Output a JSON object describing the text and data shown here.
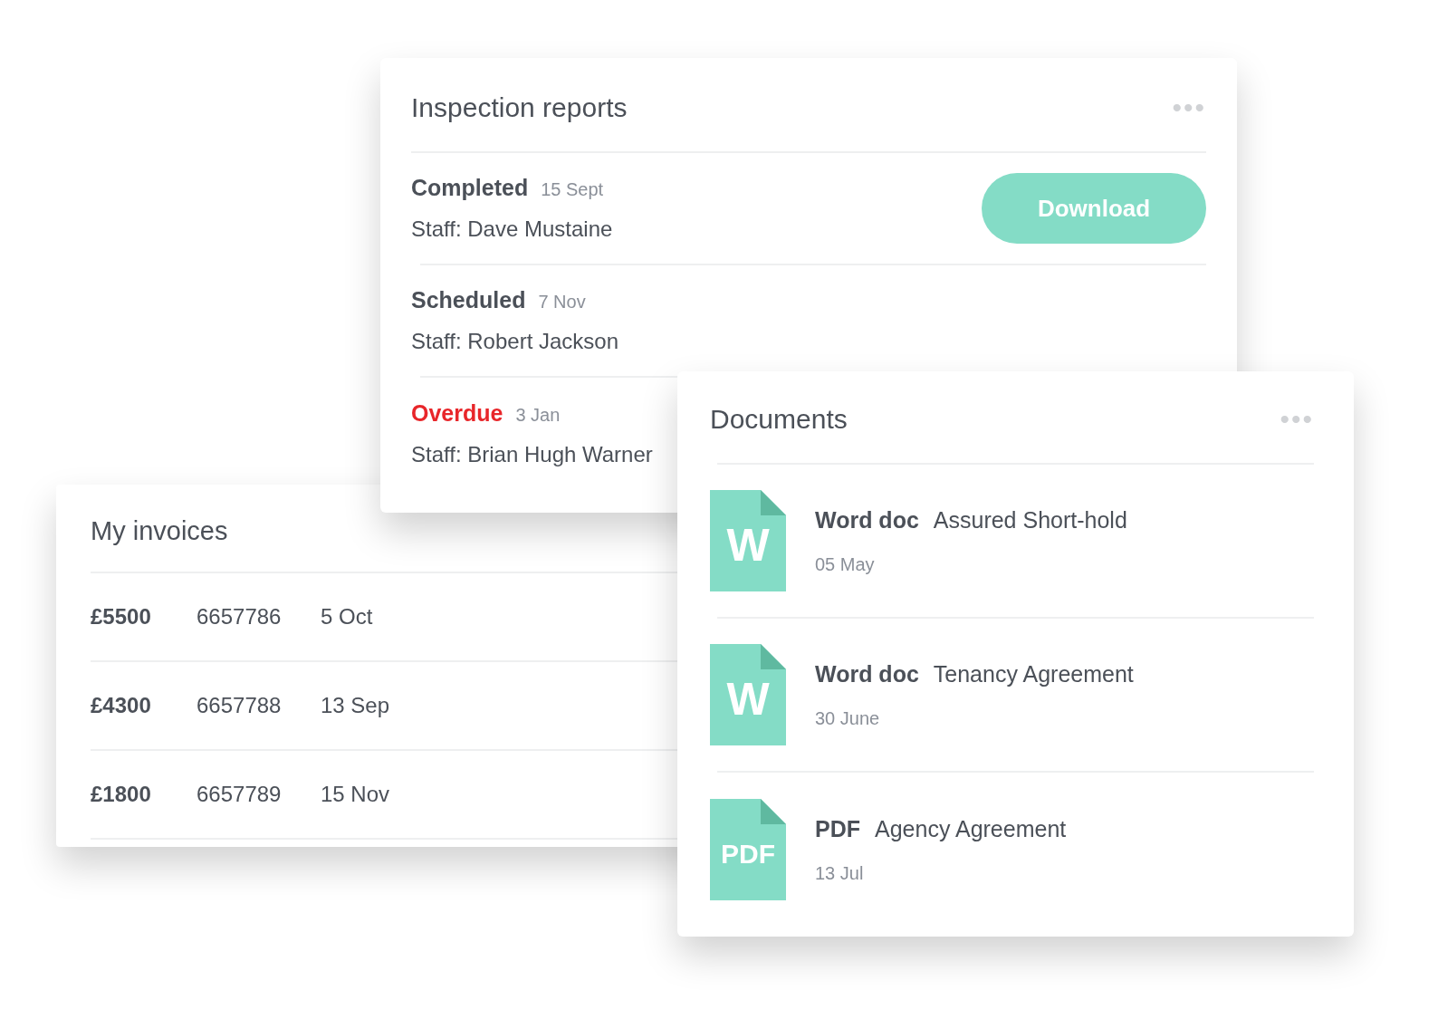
{
  "inspection": {
    "title": "Inspection reports",
    "menu": "•••",
    "rows": [
      {
        "status": "Completed",
        "kind": "normal",
        "date": "15 Sept",
        "staff": "Staff: Dave Mustaine",
        "action": "Download"
      },
      {
        "status": "Scheduled",
        "kind": "normal",
        "date": "7 Nov",
        "staff": "Staff: Robert Jackson"
      },
      {
        "status": "Overdue",
        "kind": "overdue",
        "date": "3 Jan",
        "staff": "Staff: Brian Hugh Warner"
      }
    ]
  },
  "invoices": {
    "title": "My invoices",
    "rows": [
      {
        "amount": "£5500",
        "number": "6657786",
        "date": "5 Oct"
      },
      {
        "amount": "£4300",
        "number": "6657788",
        "date": "13 Sep"
      },
      {
        "amount": "£1800",
        "number": "6657789",
        "date": "15 Nov"
      }
    ]
  },
  "documents": {
    "title": "Documents",
    "menu": "•••",
    "items": [
      {
        "icon_label": "W",
        "type": "Word doc",
        "name": "Assured Short-hold",
        "date": "05 May"
      },
      {
        "icon_label": "W",
        "type": "Word doc",
        "name": "Tenancy Agreement",
        "date": "30 June"
      },
      {
        "icon_label": "PDF",
        "type": "PDF",
        "name": "Agency Agreement",
        "date": "13 Jul"
      }
    ]
  }
}
